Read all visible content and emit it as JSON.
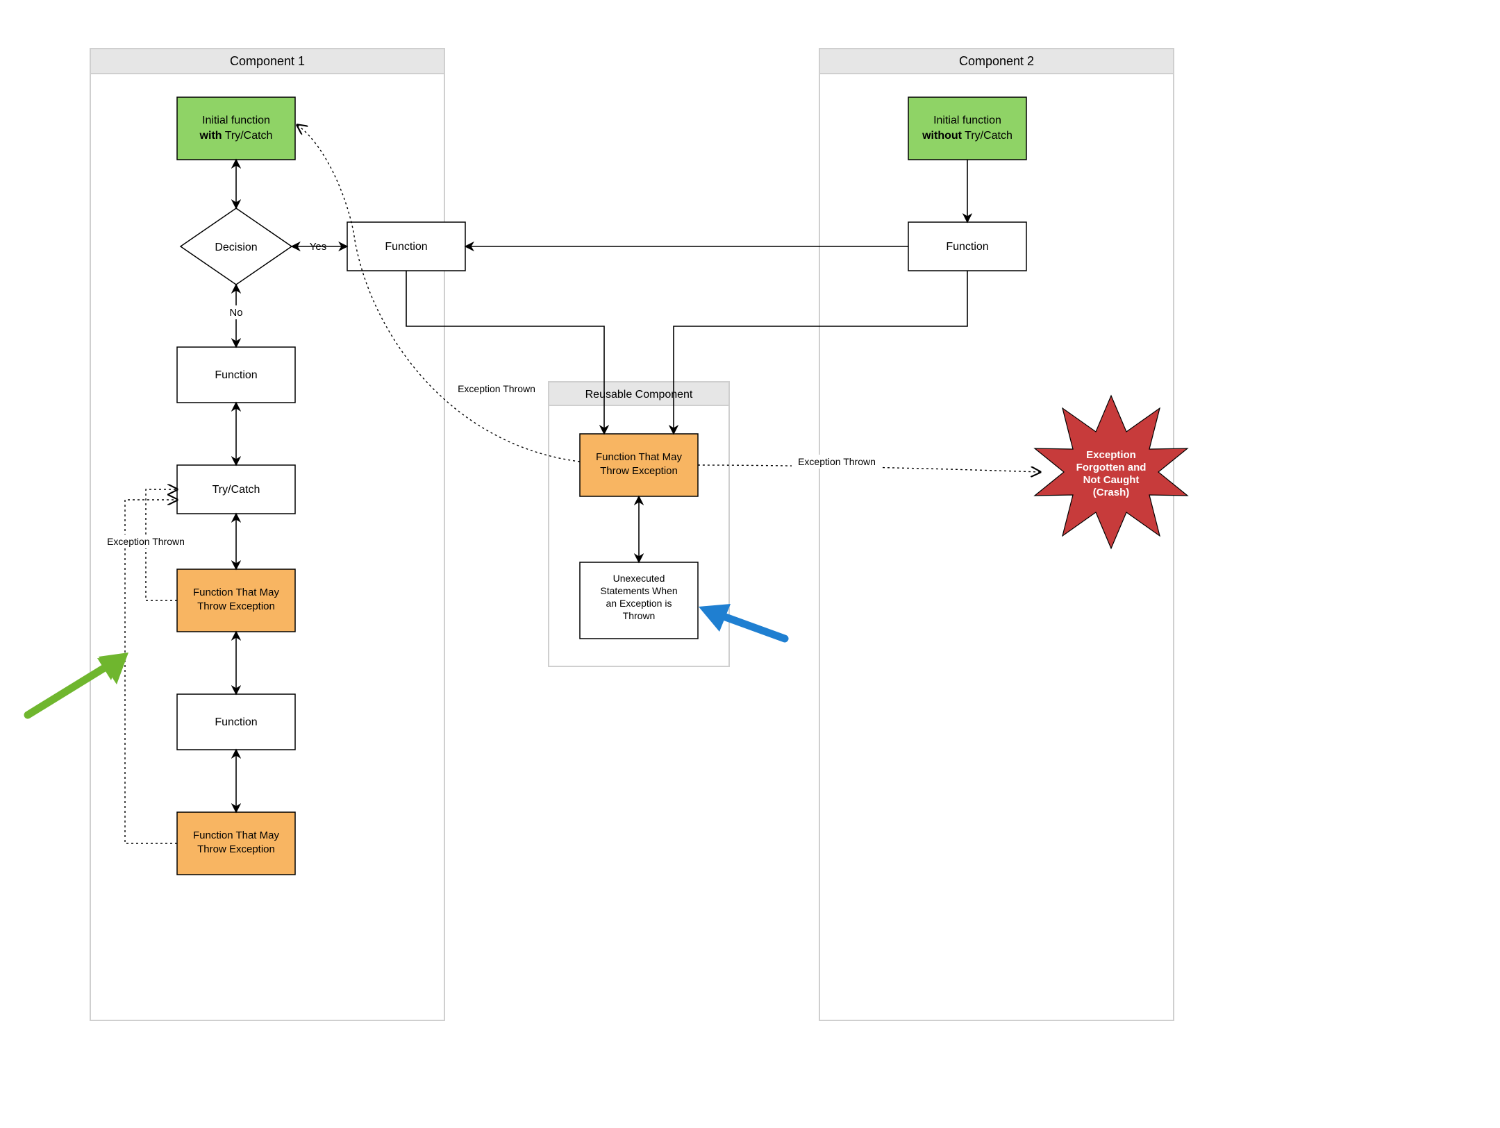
{
  "containers": {
    "comp1": {
      "title": "Component 1"
    },
    "comp2": {
      "title": "Component 2"
    },
    "reusable": {
      "title": "Reusable Component"
    }
  },
  "nodes": {
    "init1_line1": "Initial function",
    "init1_bold": "with",
    "init1_after": " Try/Catch",
    "init2_line1": "Initial function",
    "init2_bold": "without",
    "init2_after": " Try/Catch",
    "decision": "Decision",
    "function": "Function",
    "trycatch": "Try/Catch",
    "fn_throw": "Function That May\nThrow Exception",
    "unexecuted": "Unexecuted\nStatements When\nan Exception is\nThrown",
    "crash": "Exception\nForgotten and\nNot Caught\n(Crash)"
  },
  "edges": {
    "yes": "Yes",
    "no": "No",
    "exception_thrown": "Exception Thrown"
  },
  "colors": {
    "green_fill": "#8fd366",
    "orange_fill": "#f8b562",
    "red_fill": "#c73b3b",
    "header_fill": "#e6e6e6",
    "container_border": "#cfcfcf",
    "node_border": "#000",
    "green_arrow": "#6fb62e",
    "blue_arrow": "#1f7fd1"
  },
  "chart_data": {
    "type": "flowchart",
    "containers": [
      {
        "id": "comp1",
        "title": "Component 1",
        "children": [
          "init1",
          "decision",
          "fnA",
          "fnB",
          "trycatch",
          "throw1",
          "fnC",
          "throw2"
        ]
      },
      {
        "id": "reusable",
        "title": "Reusable Component",
        "children": [
          "throwR",
          "unexec"
        ]
      },
      {
        "id": "comp2",
        "title": "Component 2",
        "children": [
          "init2",
          "fnD"
        ]
      }
    ],
    "nodes": [
      {
        "id": "init1",
        "label": "Initial function with Try/Catch",
        "type": "process",
        "fill": "green"
      },
      {
        "id": "decision",
        "label": "Decision",
        "type": "decision",
        "fill": "white"
      },
      {
        "id": "fnA",
        "label": "Function",
        "type": "process",
        "fill": "white"
      },
      {
        "id": "fnB",
        "label": "Function",
        "type": "process",
        "fill": "white"
      },
      {
        "id": "trycatch",
        "label": "Try/Catch",
        "type": "process",
        "fill": "white"
      },
      {
        "id": "throw1",
        "label": "Function That May Throw Exception",
        "type": "process",
        "fill": "orange"
      },
      {
        "id": "fnC",
        "label": "Function",
        "type": "process",
        "fill": "white"
      },
      {
        "id": "throw2",
        "label": "Function That May Throw Exception",
        "type": "process",
        "fill": "orange"
      },
      {
        "id": "throwR",
        "label": "Function That May Throw Exception",
        "type": "process",
        "fill": "orange"
      },
      {
        "id": "unexec",
        "label": "Unexecuted Statements When an Exception is Thrown",
        "type": "process",
        "fill": "white"
      },
      {
        "id": "init2",
        "label": "Initial function without Try/Catch",
        "type": "process",
        "fill": "green"
      },
      {
        "id": "fnD",
        "label": "Function",
        "type": "process",
        "fill": "white"
      },
      {
        "id": "crash",
        "label": "Exception Forgotten and Not Caught (Crash)",
        "type": "burst",
        "fill": "red"
      }
    ],
    "edges": [
      {
        "from": "init1",
        "to": "decision",
        "style": "solid",
        "label": "",
        "bidir": true
      },
      {
        "from": "decision",
        "to": "fnA",
        "style": "solid",
        "label": "Yes",
        "bidir": true
      },
      {
        "from": "decision",
        "to": "fnB",
        "style": "solid",
        "label": "No",
        "bidir": true
      },
      {
        "from": "fnB",
        "to": "trycatch",
        "style": "solid",
        "label": "",
        "bidir": true
      },
      {
        "from": "trycatch",
        "to": "throw1",
        "style": "solid",
        "label": "",
        "bidir": true
      },
      {
        "from": "throw1",
        "to": "fnC",
        "style": "solid",
        "label": "",
        "bidir": true
      },
      {
        "from": "fnC",
        "to": "throw2",
        "style": "solid",
        "label": "",
        "bidir": true
      },
      {
        "from": "throw1",
        "to": "trycatch",
        "style": "dotted",
        "label": "Exception Thrown",
        "bidir": false
      },
      {
        "from": "throw2",
        "to": "trycatch",
        "style": "dotted",
        "label": "Exception Thrown",
        "bidir": false
      },
      {
        "from": "fnA",
        "to": "throwR",
        "style": "solid",
        "label": "",
        "bidir": false
      },
      {
        "from": "fnD",
        "to": "throwR",
        "style": "solid",
        "label": "",
        "bidir": false
      },
      {
        "from": "fnD",
        "to": "fnA",
        "style": "solid",
        "label": "",
        "bidir": false
      },
      {
        "from": "throwR",
        "to": "unexec",
        "style": "solid",
        "label": "",
        "bidir": true
      },
      {
        "from": "throwR",
        "to": "init1",
        "style": "dotted",
        "label": "Exception Thrown",
        "bidir": false
      },
      {
        "from": "throwR",
        "to": "crash",
        "style": "dotted",
        "label": "Exception Thrown",
        "bidir": false
      },
      {
        "from": "init2",
        "to": "fnD",
        "style": "solid",
        "label": "",
        "bidir": false
      }
    ],
    "annotations": [
      {
        "type": "pointer-arrow",
        "color": "green",
        "target": "throw1/throw2 region"
      },
      {
        "type": "pointer-arrow",
        "color": "blue",
        "target": "unexec"
      }
    ]
  }
}
